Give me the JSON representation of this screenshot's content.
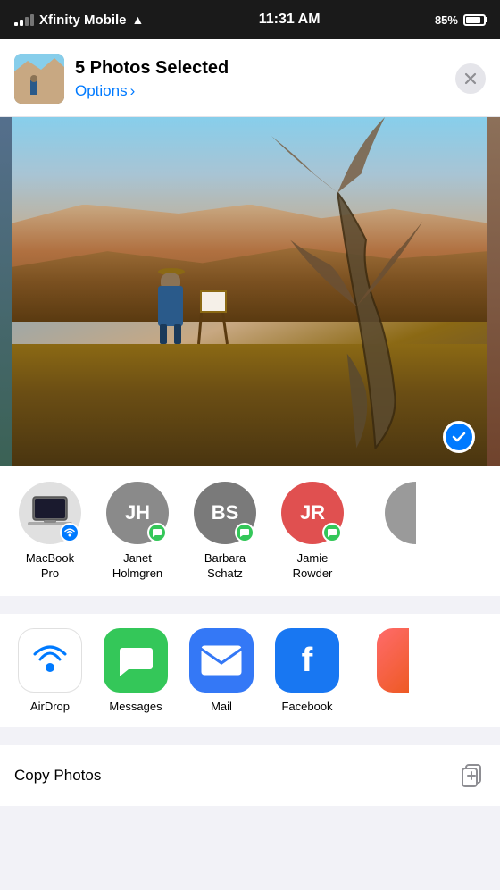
{
  "statusBar": {
    "carrier": "Xfinity Mobile",
    "time": "11:31 AM",
    "battery": "85%"
  },
  "header": {
    "title": "5 Photos Selected",
    "options": "Options",
    "closeLabel": "×"
  },
  "contacts": [
    {
      "id": "macbook-pro",
      "initials": "",
      "name": "MacBook\nPro",
      "avatarType": "macbook",
      "badge": "airdrop"
    },
    {
      "id": "janet",
      "initials": "JH",
      "name": "Janet\nHolmgren",
      "avatarType": "gray",
      "badge": "messages"
    },
    {
      "id": "barbara",
      "initials": "BS",
      "name": "Barbara\nSchatz",
      "avatarType": "gray2",
      "badge": "messages"
    },
    {
      "id": "jamie",
      "initials": "JR",
      "name": "Jamie\nRowder",
      "avatarType": "red",
      "badge": "messages"
    }
  ],
  "apps": [
    {
      "id": "airdrop",
      "name": "AirDrop",
      "type": "airdrop"
    },
    {
      "id": "messages",
      "name": "Messages",
      "type": "messages"
    },
    {
      "id": "mail",
      "name": "Mail",
      "type": "mail"
    },
    {
      "id": "facebook",
      "name": "Facebook",
      "type": "facebook"
    }
  ],
  "copySection": {
    "label": "Copy Photos"
  }
}
